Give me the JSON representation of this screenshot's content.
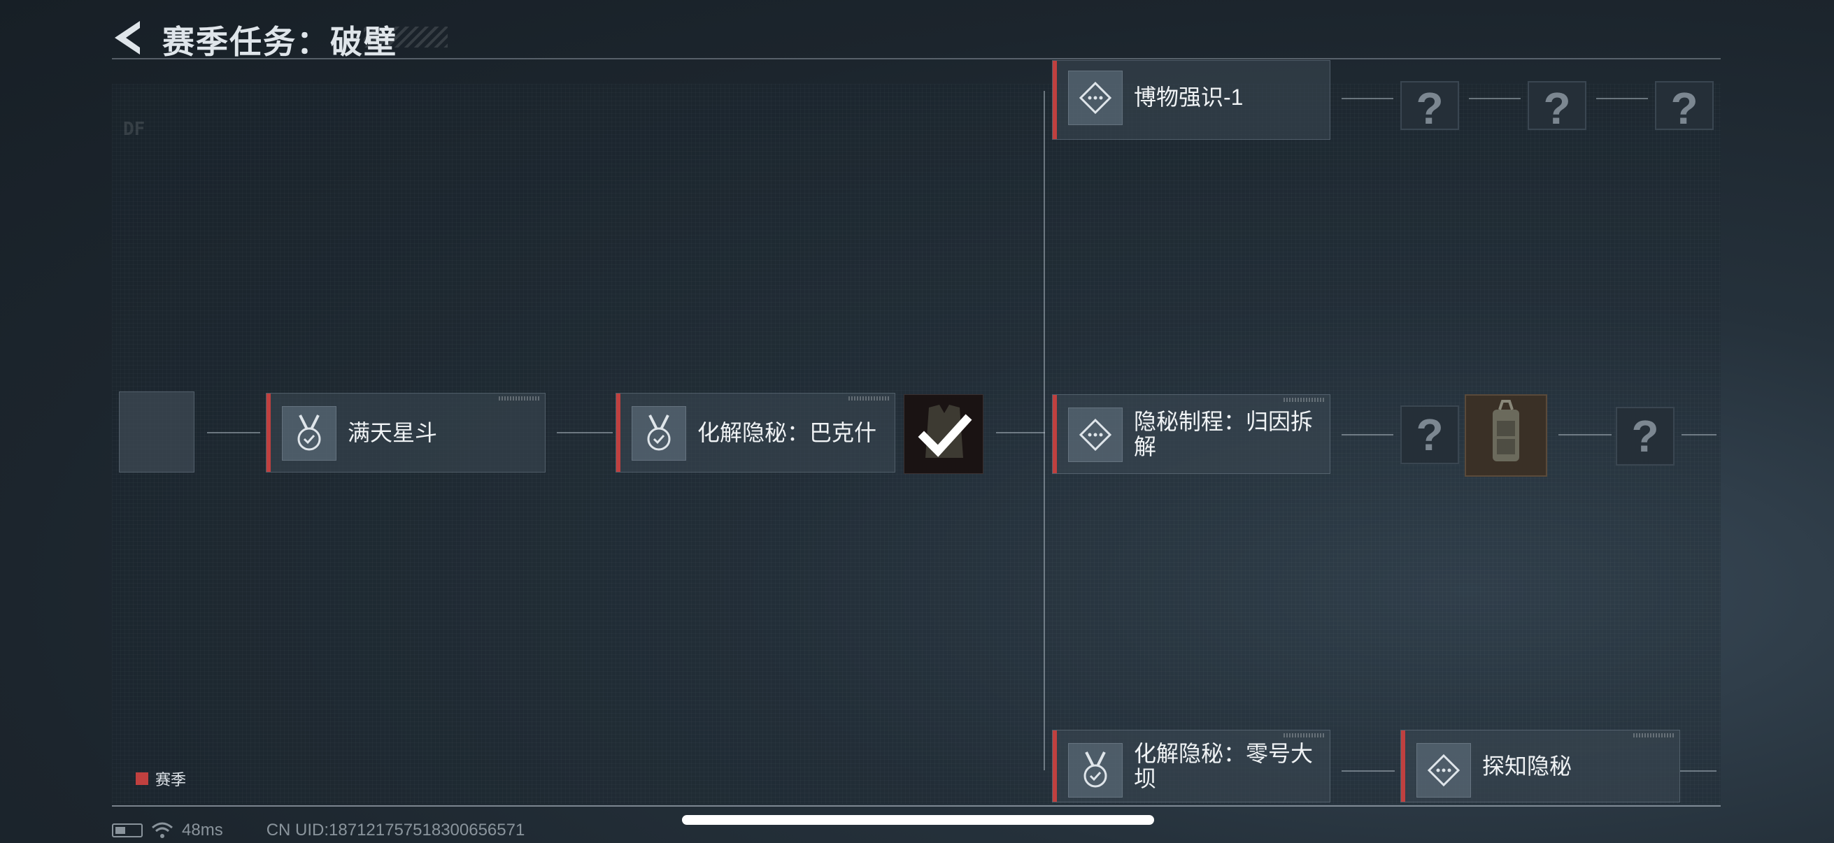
{
  "header": {
    "title": "赛季任务：破壁"
  },
  "nodes": {
    "n1": {
      "label": "满天星斗",
      "icon": "medal-check-icon"
    },
    "n2": {
      "label": "化解隐秘：巴克什",
      "icon": "medal-check-icon"
    },
    "n3": {
      "label": "博物强识-1",
      "icon": "diamond-dots-icon"
    },
    "n4": {
      "label": "隐秘制程：归因拆解",
      "icon": "diamond-dots-icon"
    },
    "n5": {
      "label": "化解隐秘：零号大坝",
      "icon": "medal-check-icon"
    },
    "n6": {
      "label": "探知隐秘",
      "icon": "diamond-dots-icon"
    }
  },
  "unknown_mark": "?",
  "legend": {
    "label": "赛季",
    "color": "#c0403f"
  },
  "deco": {
    "prefix": "DF"
  },
  "status": {
    "ping": "48ms",
    "uid": "CN UID:187121757518300656571"
  }
}
